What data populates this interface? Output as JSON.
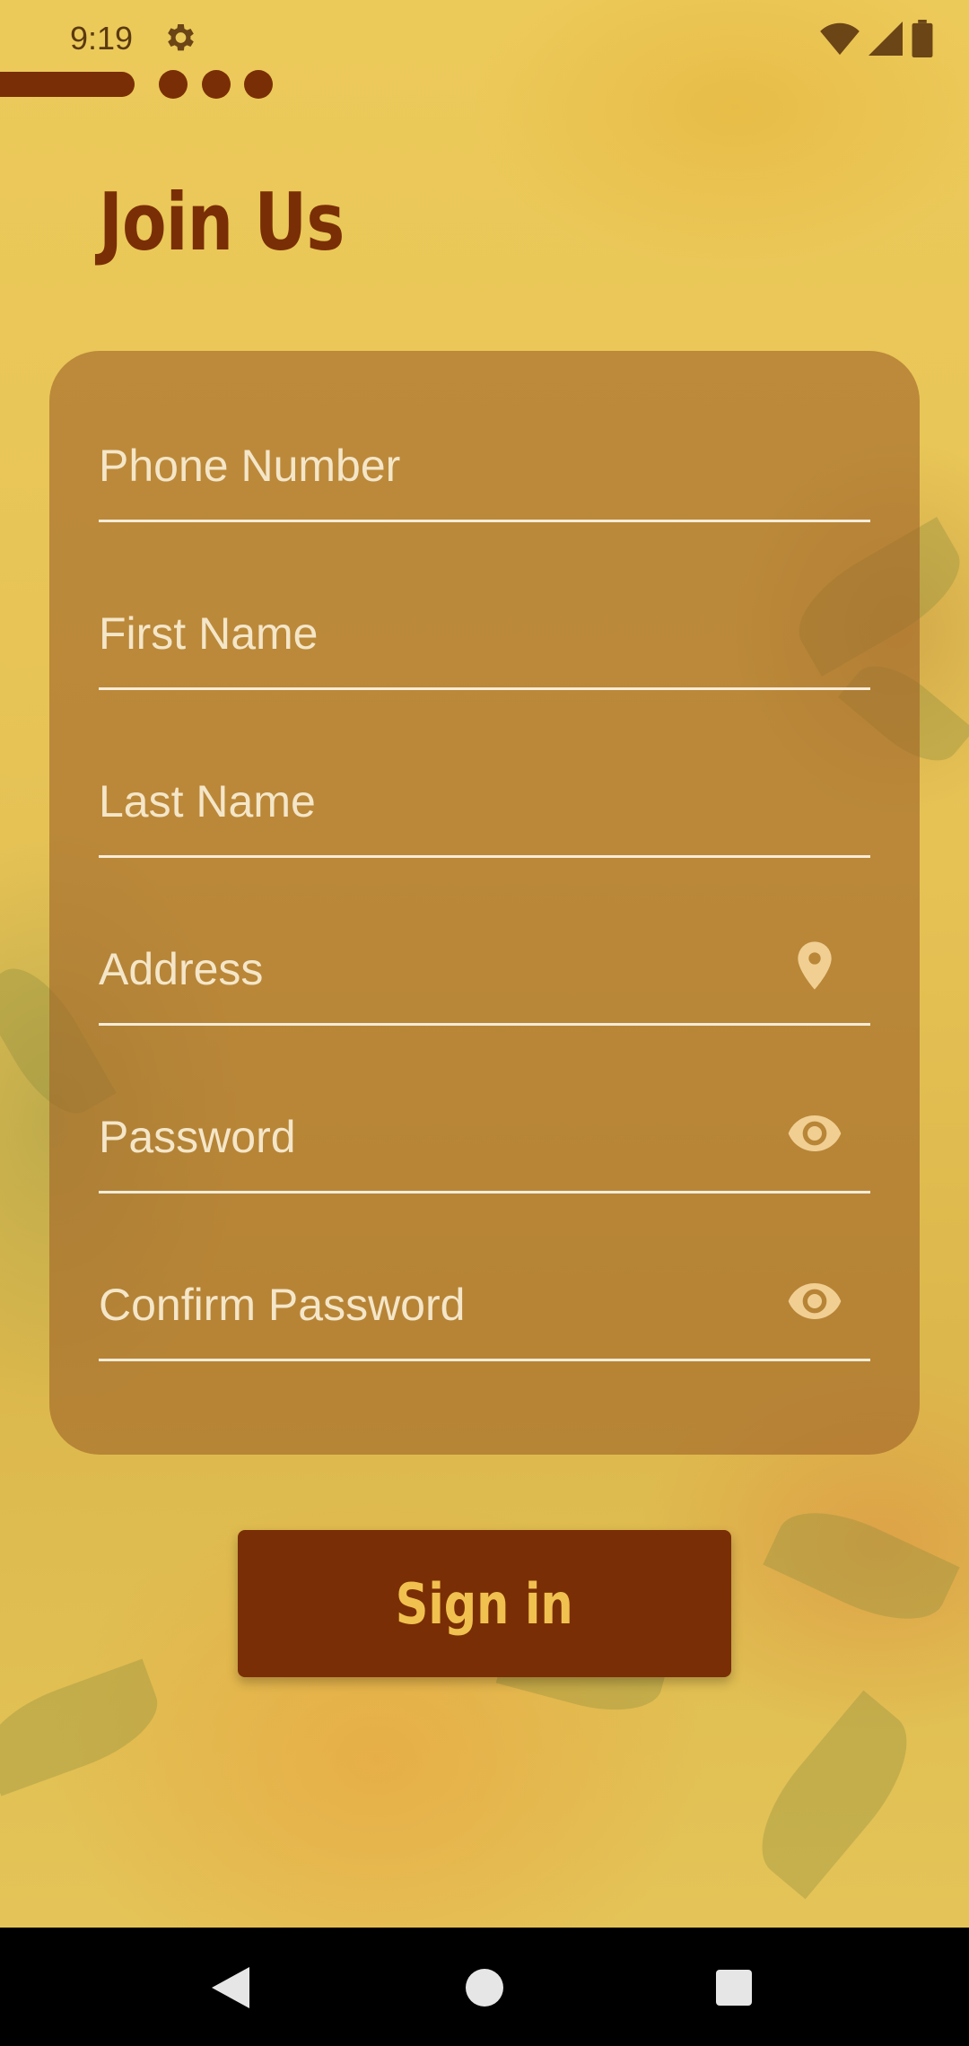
{
  "status_bar": {
    "time": "9:19",
    "icons": [
      "settings-icon",
      "wifi-icon",
      "cell-signal-icon",
      "battery-icon"
    ]
  },
  "progress": {
    "icons": [
      "progress-bar",
      "progress-dot",
      "progress-dot",
      "progress-dot"
    ]
  },
  "header": {
    "title": "Join Us"
  },
  "form": {
    "phone_placeholder": "Phone Number",
    "first_name_placeholder": "First Name",
    "last_name_placeholder": "Last Name",
    "address_placeholder": "Address",
    "password_placeholder": "Password",
    "confirm_password_placeholder": "Confirm Password",
    "address_icon": "location-pin-icon",
    "password_icon": "eye-icon",
    "confirm_password_icon": "eye-icon"
  },
  "actions": {
    "signin_label": "Sign in"
  },
  "colors": {
    "accent": "#7a2e06",
    "button_text": "#f1c14f",
    "background": "#e8c253",
    "card": "#a0642899"
  },
  "nav": {
    "icons": [
      "back-icon",
      "home-icon",
      "recent-apps-icon"
    ]
  }
}
